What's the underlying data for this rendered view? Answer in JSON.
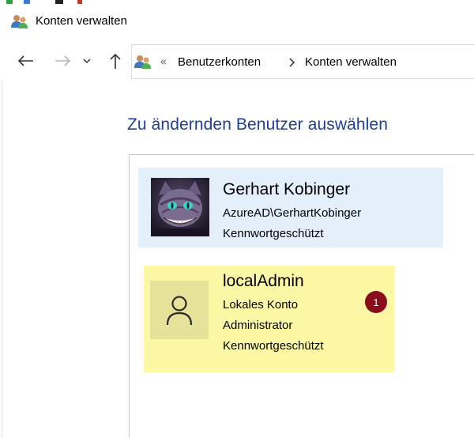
{
  "window": {
    "title": "Konten verwalten",
    "icon": "users-icon"
  },
  "nav": {
    "back_icon": "back-arrow-icon",
    "forward_icon": "forward-arrow-icon",
    "recent_icon": "chevron-down-icon",
    "up_icon": "up-arrow-icon"
  },
  "address": {
    "icon": "users-icon",
    "overflow": "«",
    "crumbs": [
      "Benutzerkonten",
      "Konten verwalten"
    ]
  },
  "main": {
    "heading": "Zu ändernden Benutzer auswählen"
  },
  "accounts": [
    {
      "name": "Gerhart Kobinger",
      "lines": [
        "AzureAD\\GerhartKobinger",
        "Kennwortgeschützt"
      ],
      "avatar": "cheshire-cat-avatar",
      "highlight": "#e3f0fc"
    },
    {
      "name": "localAdmin",
      "lines": [
        "Lokales Konto",
        "Administrator",
        "Kennwortgeschützt"
      ],
      "avatar": "person-icon",
      "highlight": "#fdf8a6"
    }
  ],
  "badge": {
    "label": "1",
    "color": "#8b0d1b"
  },
  "colors": {
    "heading": "#1e3e9b",
    "selected_blue": "#e3f0fc",
    "selected_yellow": "#fdf8a6"
  }
}
